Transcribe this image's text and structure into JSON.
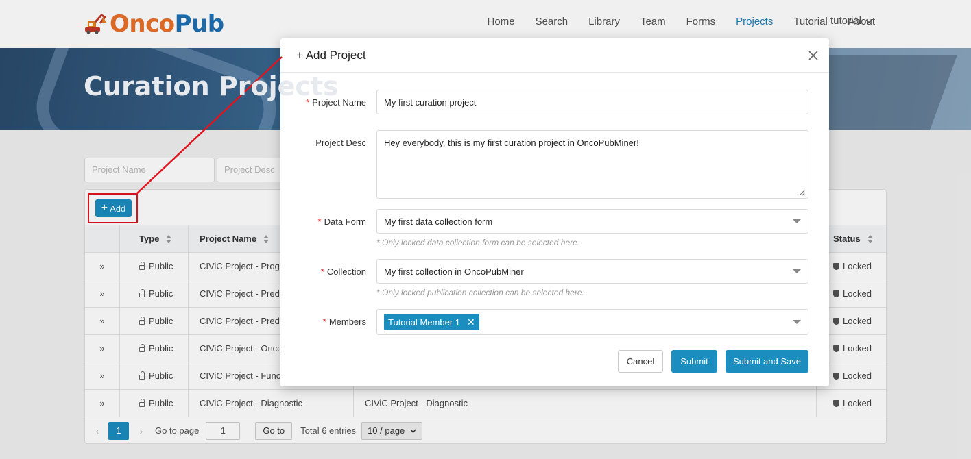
{
  "header": {
    "logo_text": "OncoPub",
    "nav": [
      "Home",
      "Search",
      "Library",
      "Team",
      "Forms",
      "Projects",
      "Tutorial",
      "About"
    ],
    "active_nav": "Projects",
    "user_menu": "tutorial"
  },
  "banner": {
    "title": "Curation Projects"
  },
  "filters": {
    "project_name_placeholder": "Project Name",
    "project_desc_placeholder": "Project Desc"
  },
  "toolbar": {
    "add_label": "Add"
  },
  "table": {
    "headers": {
      "type": "Type",
      "project_name": "Project Name",
      "status": "Status"
    },
    "rows": [
      {
        "type": "Public",
        "name": "CIViC Project - Prognostic",
        "desc": "",
        "status": "Locked"
      },
      {
        "type": "Public",
        "name": "CIViC Project - Predisposing",
        "desc": "",
        "status": "Locked"
      },
      {
        "type": "Public",
        "name": "CIViC Project - Predictive",
        "desc": "",
        "status": "Locked"
      },
      {
        "type": "Public",
        "name": "CIViC Project - Oncogenic",
        "desc": "",
        "status": "Locked"
      },
      {
        "type": "Public",
        "name": "CIViC Project - Functional",
        "desc": "",
        "status": "Locked"
      },
      {
        "type": "Public",
        "name": "CIViC Project - Diagnostic",
        "desc": "CIViC Project - Diagnostic",
        "status": "Locked"
      }
    ]
  },
  "pagination": {
    "current_page": "1",
    "goto_label": "Go to page",
    "goto_value": "1",
    "goto_button": "Go to",
    "total": "Total 6 entries",
    "page_size": "10 / page"
  },
  "modal": {
    "title": "+ Add Project",
    "fields": {
      "project_name": {
        "label": "Project Name",
        "value": "My first curation project"
      },
      "project_desc": {
        "label": "Project Desc",
        "value": "Hey everybody, this is my first curation project in OncoPubMiner!"
      },
      "data_form": {
        "label": "Data Form",
        "value": "My first data collection form",
        "hint": "* Only locked data collection form can be selected here."
      },
      "collection": {
        "label": "Collection",
        "value": "My first collection in OncoPubMiner",
        "hint": "* Only locked publication collection can be selected here."
      },
      "members": {
        "label": "Members",
        "tags": [
          "Tutorial Member 1"
        ]
      }
    },
    "buttons": {
      "cancel": "Cancel",
      "submit": "Submit",
      "submit_save": "Submit and Save"
    }
  },
  "colors": {
    "primary": "#1b8dbf",
    "annotation": "#e0141e",
    "required": "#e02020"
  }
}
